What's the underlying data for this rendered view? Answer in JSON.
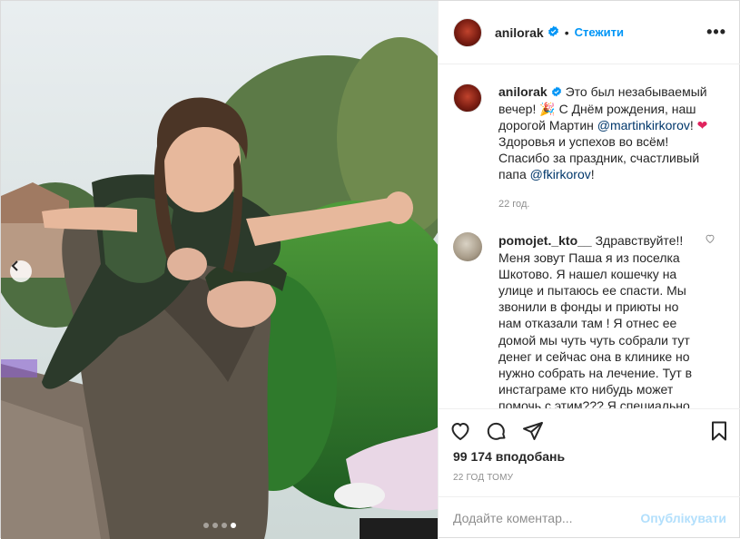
{
  "post": {
    "username": "anilorak",
    "follow_label": "Стежити",
    "more_label": "•••",
    "verified_icon": "verified-badge-icon",
    "accent": "#0095f6"
  },
  "caption": {
    "username": "anilorak",
    "text_1": " Это был незабываемый вечер! ",
    "text_2": " С Днём рождения, наш дорогой Мартин ",
    "mention_1": "@martinkirkorov",
    "text_3": "!",
    "text_4": " Здоровья и успехов во всём! Спасибо за праздник, счастливый папа ",
    "mention_2": "@fkirkorov",
    "text_5": "!",
    "time": "22 год."
  },
  "comment": {
    "username": "pomojet._kto__",
    "text": " Здравствуйте!! Меня зовут Паша я из поселка Шкотово. Я нашел кошечку на улице и пытаюсь ее спасти. Мы звонили в фонды и приюты но нам отказали там ! Я отнес ее домой мы чуть чуть собрали тут денег и сейчас она в клинике но нужно собрать на лечение. Тут в инстаграме кто нибудь может помочь с этим??? Я специально"
  },
  "stats": {
    "likes": "99 174 вподобань",
    "ago": "22 ГОД ТОМУ"
  },
  "add_comment": {
    "placeholder": "Додайте коментар...",
    "publish_label": "Опублікувати"
  },
  "carousel": {
    "total": 4,
    "active_index": 4
  }
}
